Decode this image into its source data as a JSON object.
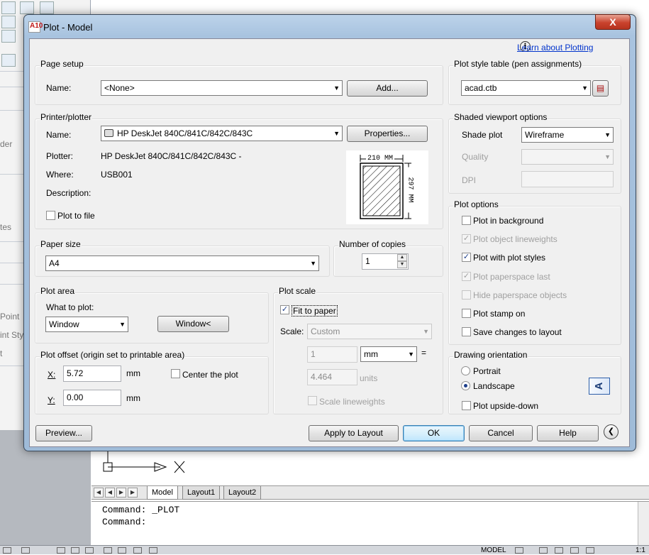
{
  "background": {
    "left_panel_ghost": [
      "der",
      "tes",
      "Point",
      "int Sty",
      "t"
    ],
    "layout_tabs": [
      "Model",
      "Layout1",
      "Layout2"
    ],
    "command_lines": [
      "Command:  _PLOT",
      "Command:"
    ],
    "status": {
      "model": "MODEL",
      "scale": "1:1"
    }
  },
  "dialog": {
    "title": "Plot - Model",
    "title_icon_text": "A10",
    "close_symbol": "X",
    "help_link": "Learn about Plotting",
    "page_setup": {
      "title": "Page setup",
      "name_label": "Name:",
      "name_value": "<None>",
      "add_button": "Add..."
    },
    "printer": {
      "title": "Printer/plotter",
      "name_label": "Name:",
      "name_value": "HP DeskJet 840C/841C/842C/843C",
      "properties_button": "Properties...",
      "plotter_label": "Plotter:",
      "plotter_value": "HP DeskJet 840C/841C/842C/843C -",
      "where_label": "Where:",
      "where_value": "USB001",
      "description_label": "Description:",
      "plot_to_file": "Plot to file",
      "preview_width": "210  MM",
      "preview_height": "297  MM"
    },
    "paper_size": {
      "title": "Paper size",
      "value": "A4"
    },
    "copies": {
      "title": "Number of copies",
      "value": "1"
    },
    "plot_area": {
      "title": "Plot area",
      "what_label": "What to plot:",
      "what_value": "Window",
      "window_button": "Window<"
    },
    "plot_scale": {
      "title": "Plot scale",
      "fit_to_paper": "Fit to paper",
      "scale_label": "Scale:",
      "scale_value": "Custom",
      "value1": "1",
      "unit": "mm",
      "equals": "=",
      "value2": "4.464",
      "units_label": "units",
      "scale_lineweights": "Scale lineweights"
    },
    "plot_offset": {
      "title": "Plot offset (origin set to printable area)",
      "x_label": "X:",
      "x_value": "5.72",
      "x_unit": "mm",
      "y_label": "Y:",
      "y_value": "0.00",
      "y_unit": "mm",
      "center_plot": "Center the plot"
    },
    "plot_style_table": {
      "title": "Plot style table (pen assignments)",
      "value": "acad.ctb"
    },
    "shaded": {
      "title": "Shaded viewport options",
      "shade_label": "Shade plot",
      "shade_value": "Wireframe",
      "quality_label": "Quality",
      "dpi_label": "DPI"
    },
    "plot_options": {
      "title": "Plot options",
      "items": [
        {
          "label": "Plot in background",
          "checked": false,
          "disabled": false
        },
        {
          "label": "Plot object lineweights",
          "checked": true,
          "disabled": true
        },
        {
          "label": "Plot with plot styles",
          "checked": true,
          "disabled": false
        },
        {
          "label": "Plot paperspace last",
          "checked": true,
          "disabled": true
        },
        {
          "label": "Hide paperspace objects",
          "checked": false,
          "disabled": true
        },
        {
          "label": "Plot stamp on",
          "checked": false,
          "disabled": false
        },
        {
          "label": "Save changes to layout",
          "checked": false,
          "disabled": false
        }
      ]
    },
    "orientation": {
      "title": "Drawing orientation",
      "portrait": "Portrait",
      "landscape": "Landscape",
      "upside_down": "Plot upside-down",
      "selected": "landscape",
      "icon_letter": "A"
    },
    "buttons": {
      "preview": "Preview...",
      "apply": "Apply to Layout",
      "ok": "OK",
      "cancel": "Cancel",
      "help": "Help"
    }
  }
}
